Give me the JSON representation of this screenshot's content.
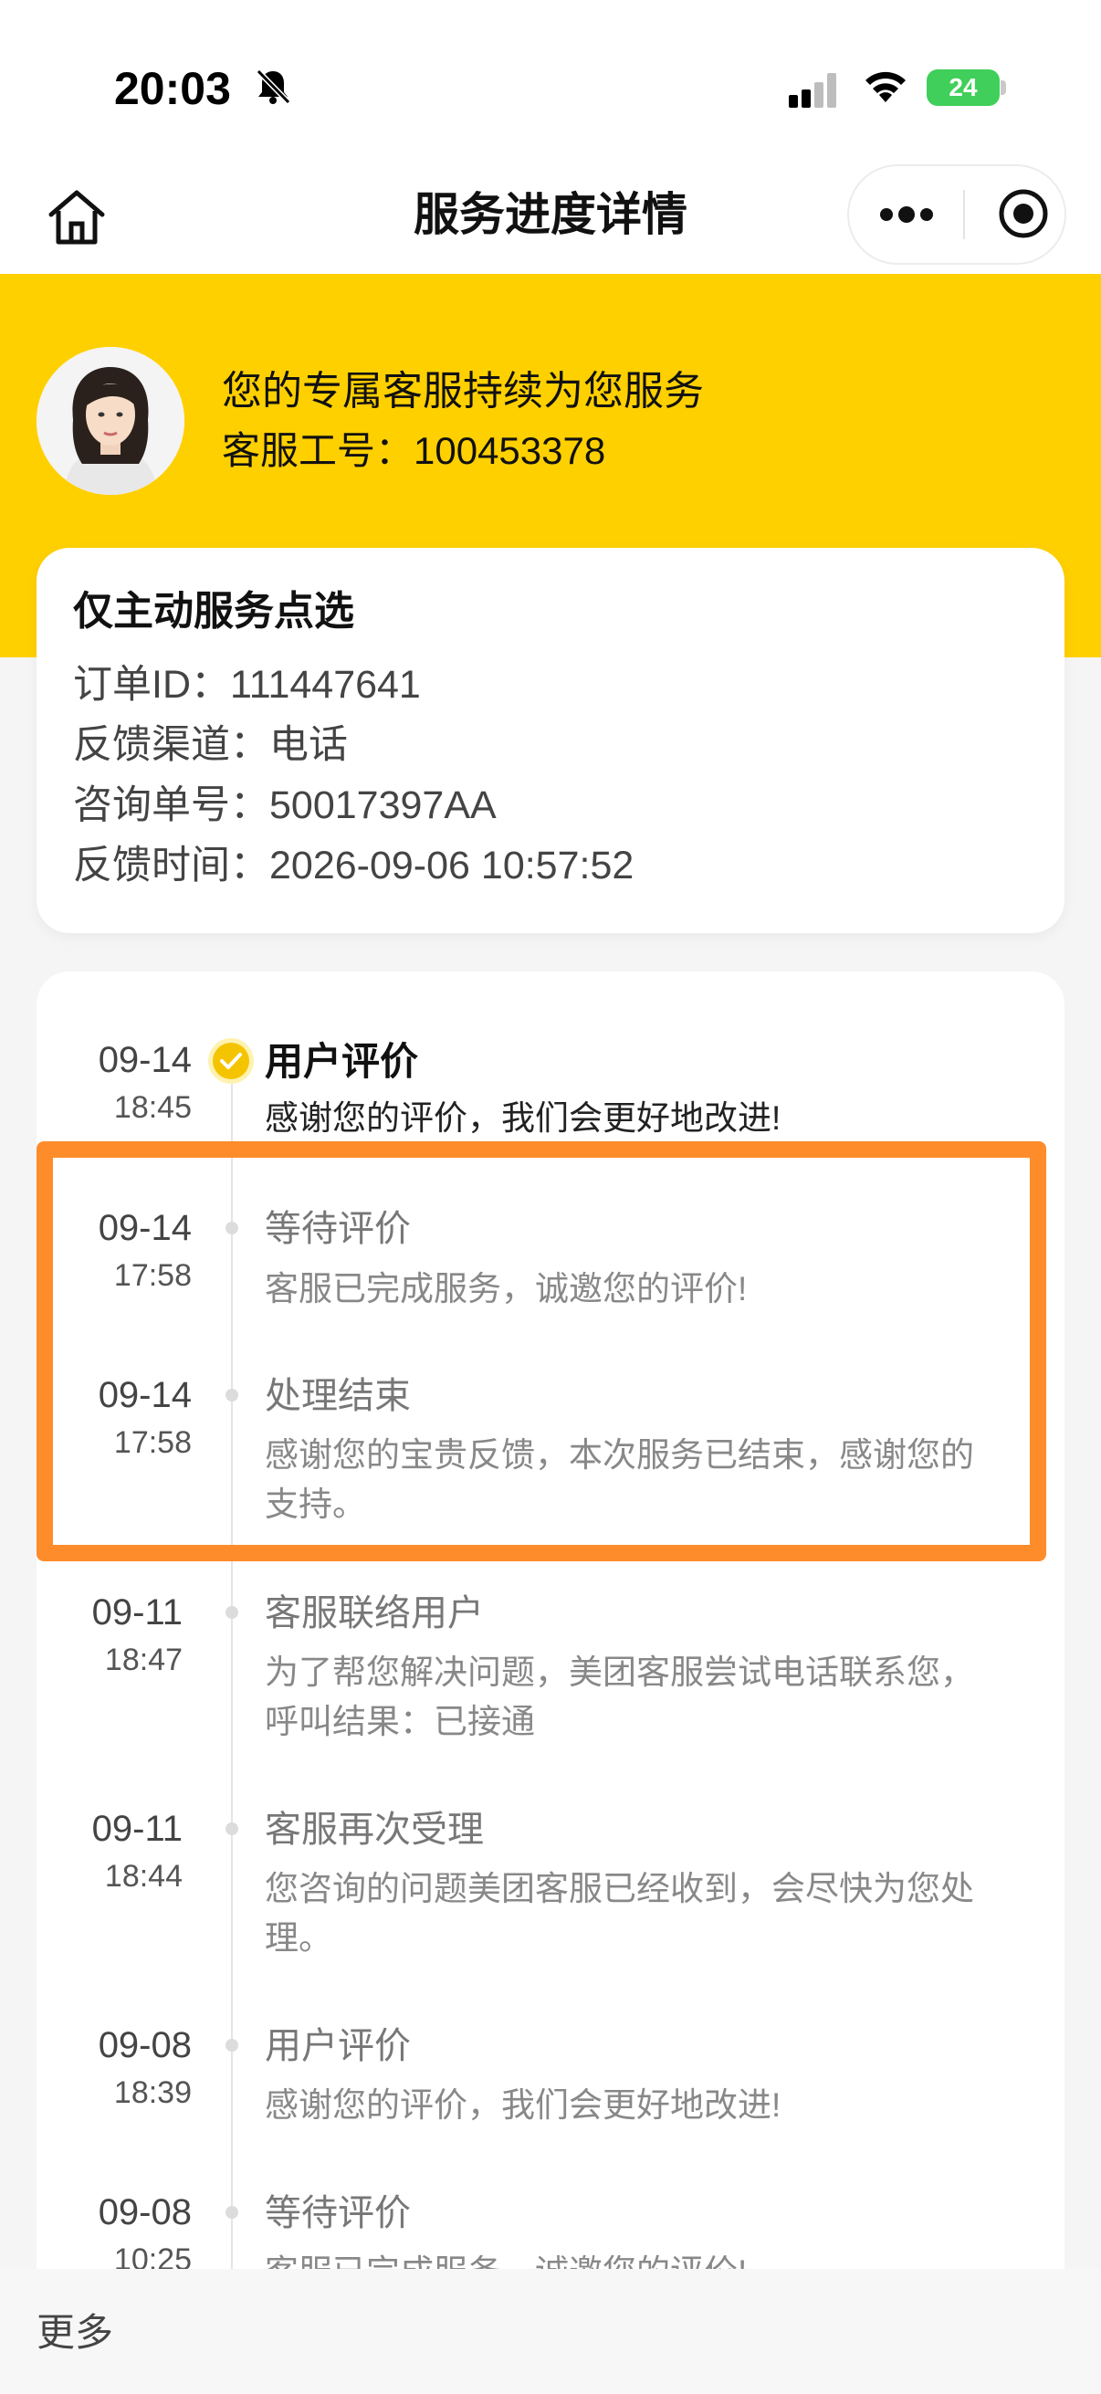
{
  "status_bar": {
    "time": "20:03",
    "battery_level": "24",
    "icons": [
      "bell-off-icon",
      "signal-icon",
      "wifi-icon",
      "battery-icon"
    ]
  },
  "nav": {
    "title": "服务进度详情",
    "icons": [
      "home-icon",
      "more-icon",
      "target-icon"
    ]
  },
  "header": {
    "service_message": "您的专属客服持续为您服务",
    "agent_id": "客服工号：100453378"
  },
  "info_card": {
    "title": "仅主动服务点选",
    "order_id": "订单ID：111447641",
    "channel": "反馈渠道：电话",
    "consult_no": "咨询单号：50017397AA",
    "feedback_time": "反馈时间：2026-09-06 10:57:52"
  },
  "timeline": [
    {
      "date": "09-14",
      "time": "18:45",
      "title": "用户评价",
      "desc": "感谢您的评价，我们会更好地改进!",
      "active": true
    },
    {
      "date": "09-14",
      "time": "17:58",
      "title": "等待评价",
      "desc": "客服已完成服务，诚邀您的评价!"
    },
    {
      "date": "09-14",
      "time": "17:58",
      "title": "处理结束",
      "desc": "感谢您的宝贵反馈，本次服务已结束，感谢您的支持。"
    },
    {
      "date": "09-11",
      "time": "18:47",
      "title": "客服联络用户",
      "desc": "为了帮您解决问题，美团客服尝试电话联系您，呼叫结果：已接通"
    },
    {
      "date": "09-11",
      "time": "18:44",
      "title": "客服再次受理",
      "desc": "您咨询的问题美团客服已经收到，会尽快为您处理。"
    },
    {
      "date": "09-08",
      "time": "18:39",
      "title": "用户评价",
      "desc": "感谢您的评价，我们会更好地改进!"
    },
    {
      "date": "09-08",
      "time": "10:25",
      "title": "等待评价",
      "desc": "客服已完成服务，诚邀您的评价!"
    }
  ],
  "footer": {
    "more_label": "更多"
  },
  "colors": {
    "brand_yellow": "#ffd000",
    "highlight_orange": "#ff8c2a",
    "check_gold": "#f5c400"
  }
}
